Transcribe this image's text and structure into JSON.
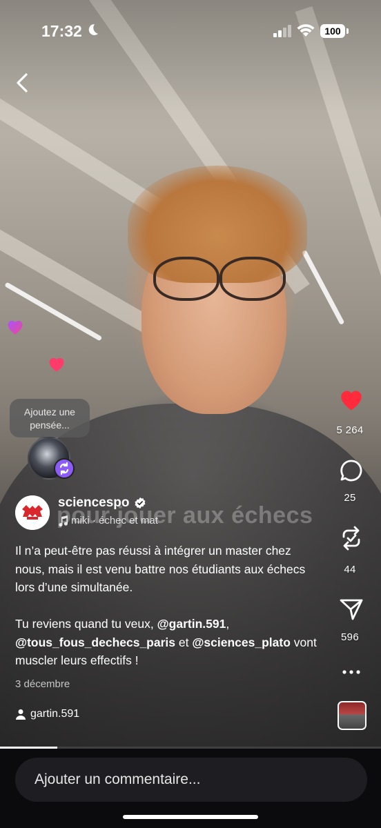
{
  "status_bar": {
    "time": "17:32",
    "battery": "100"
  },
  "video": {
    "overlay_text": "pour jouer aux échecs",
    "progress_fraction": 0.15
  },
  "thought_bubble": {
    "text_line1": "Ajoutez une",
    "text_line2": "pensée..."
  },
  "rail": {
    "likes": "5 264",
    "comments": "25",
    "reposts": "44",
    "shares": "596",
    "like_color": "#ff2b3d"
  },
  "post": {
    "account": "sciencespo",
    "audio": "miki · échec et mat",
    "caption_line1": "Il n’a peut-être pas réussi à intégrer un master chez nous, mais il est venu battre nos étudiants aux échecs lors d’une simultanée.",
    "caption_p2_prefix": "Tu reviens quand tu veux, ",
    "mention1": "@gartin.591",
    "caption_p2_sep1": ", ",
    "mention2": "@tous_fous_dechecs_paris",
    "caption_p2_sep2": " et ",
    "mention3": "@sciences_plato",
    "caption_p2_suffix": " vont muscler leurs effectifs !",
    "date": "3 décembre",
    "tagged_user": "gartin.591"
  },
  "comment_bar": {
    "placeholder": "Ajouter un commentaire..."
  },
  "icons": {
    "back": "chevron-left-icon",
    "like": "heart-icon",
    "comment": "comment-bubble-icon",
    "repost": "repost-icon",
    "share": "send-icon",
    "more": "more-icon"
  }
}
